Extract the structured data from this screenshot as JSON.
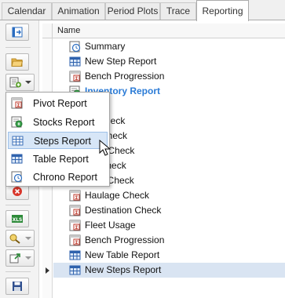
{
  "tabs": [
    {
      "label": "Calendar"
    },
    {
      "label": "Animation"
    },
    {
      "label": "Period Plots"
    },
    {
      "label": "Trace"
    },
    {
      "label": "Reporting"
    }
  ],
  "active_tab": "Reporting",
  "grid": {
    "column_header": "Name",
    "rows": [
      {
        "label": "Summary",
        "icon": "clock-report-icon"
      },
      {
        "label": "New Step Report",
        "icon": "table-report-icon"
      },
      {
        "label": "Bench Progression",
        "icon": "pivot-report-icon"
      },
      {
        "label": "Inventory Report",
        "icon": "stocks-report-icon"
      },
      {
        "label": "n",
        "icon": "pivot-report-icon"
      },
      {
        "label": "tor Check",
        "icon": "pivot-report-icon"
      },
      {
        "label": "me Check",
        "icon": "pivot-report-icon"
      },
      {
        "label": "ation Check",
        "icon": "pivot-report-icon"
      },
      {
        "label": "gic Check",
        "icon": "pivot-report-icon"
      },
      {
        "label": "Rate Check",
        "icon": "pivot-report-icon"
      },
      {
        "label": "Haulage Check",
        "icon": "pivot-report-icon"
      },
      {
        "label": "Destination Check",
        "icon": "pivot-report-icon"
      },
      {
        "label": "Fleet Usage",
        "icon": "pivot-report-icon"
      },
      {
        "label": "Bench Progression",
        "icon": "pivot-report-icon"
      },
      {
        "label": "New Table Report",
        "icon": "table-report-icon"
      },
      {
        "label": "New Steps Report",
        "icon": "table-report-icon"
      }
    ]
  },
  "menu": {
    "items": [
      {
        "label": "Pivot Report",
        "icon": "pivot-report-icon"
      },
      {
        "label": "Stocks Report",
        "icon": "stocks-report-icon"
      },
      {
        "label": "Steps Report",
        "icon": "steps-report-icon"
      },
      {
        "label": "Table Report",
        "icon": "table-report-icon"
      },
      {
        "label": "Chrono Report",
        "icon": "chrono-report-icon"
      }
    ],
    "hovered": "Steps Report"
  },
  "colors": {
    "accent_blue": "#2b7bd6",
    "menu_hover": "#d7e6f7",
    "focused_row": "#d9e4f2"
  }
}
